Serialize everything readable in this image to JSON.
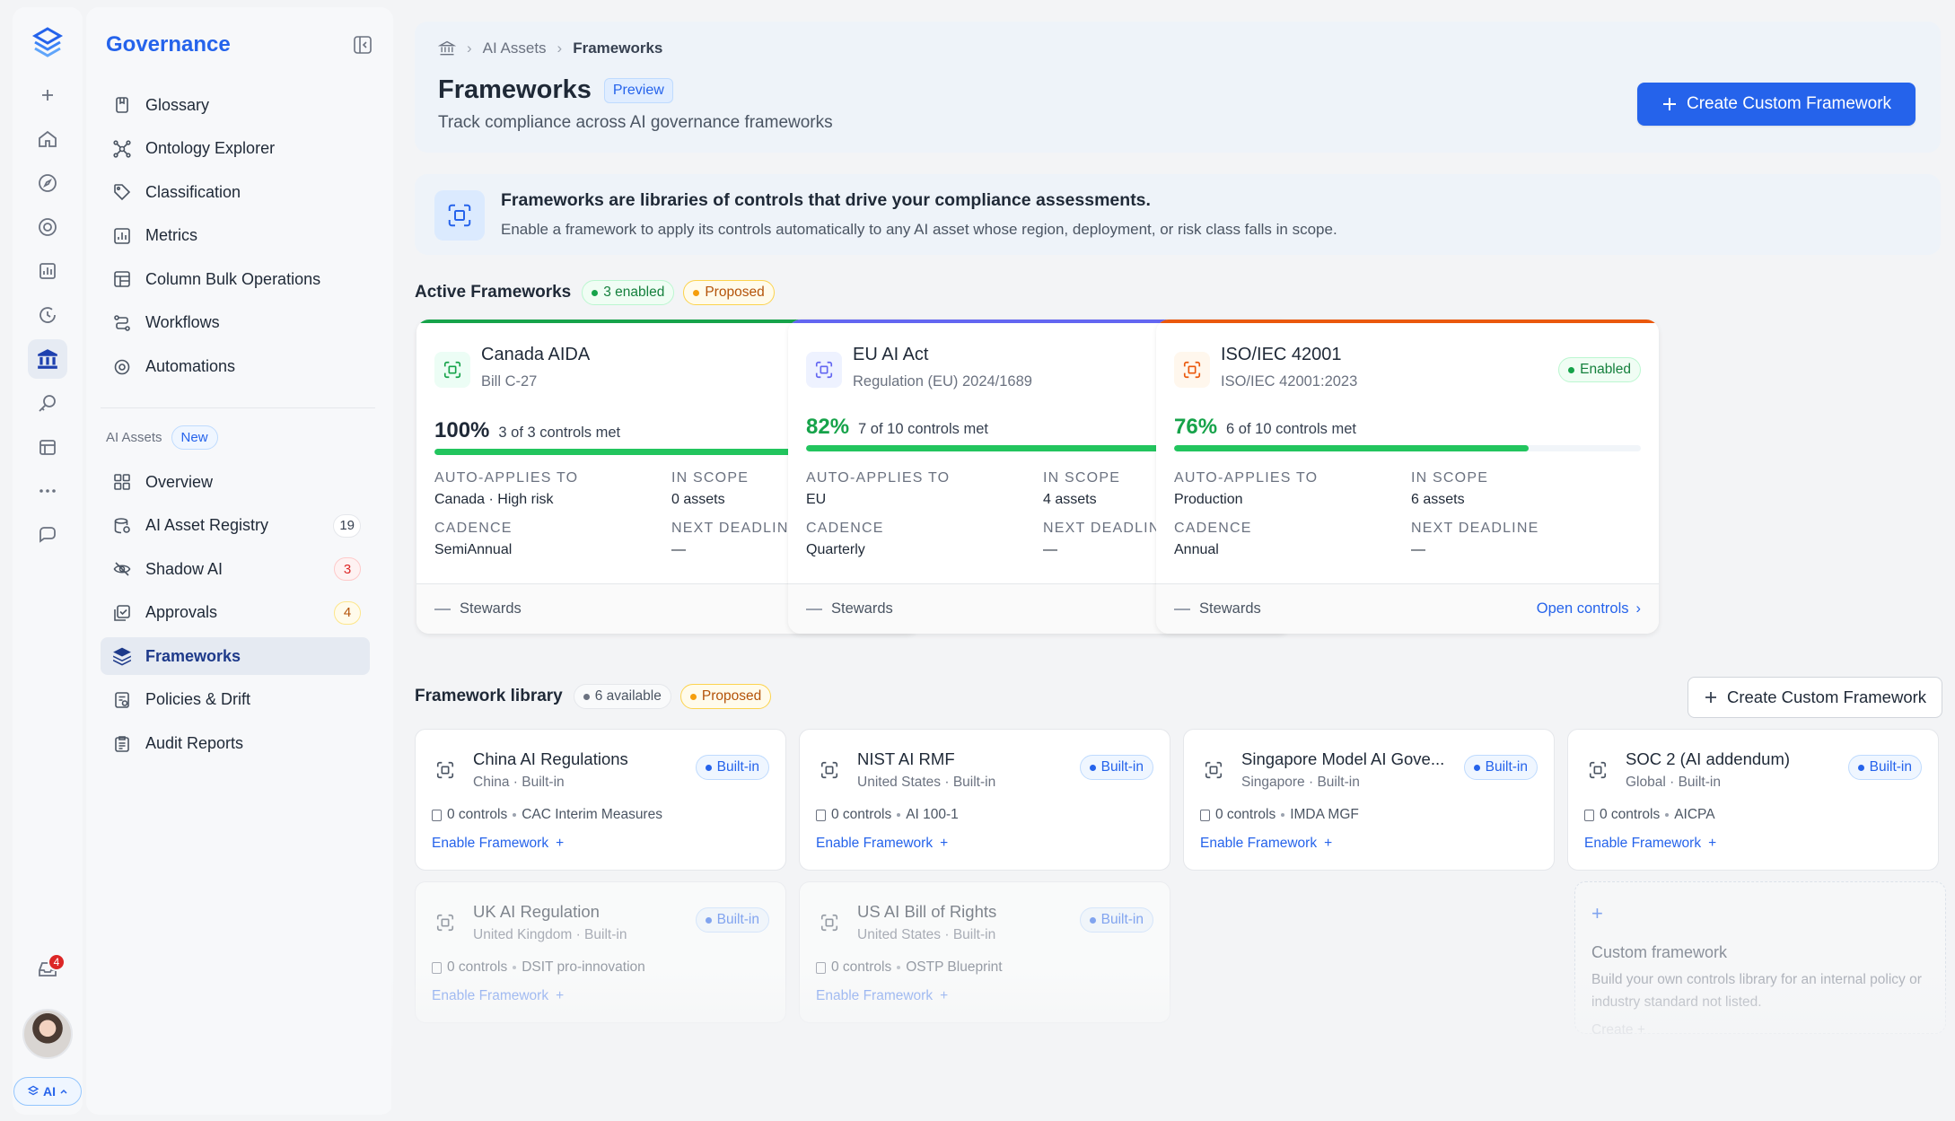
{
  "rail": {
    "icons": [
      "logo-stack-icon",
      "plus-icon",
      "home-icon",
      "compass-icon",
      "target-icon",
      "chart-icon",
      "refresh-clock-icon",
      "governance-bank-icon",
      "key-search-icon",
      "calendar-grid-icon",
      "more-icon",
      "chat-icon"
    ],
    "inbox_count": "4",
    "ai_label": "AI"
  },
  "sidebar": {
    "title": "Governance",
    "items": [
      {
        "label": "Glossary",
        "icon": "book-icon"
      },
      {
        "label": "Ontology Explorer",
        "icon": "graph-icon"
      },
      {
        "label": "Classification",
        "icon": "tag-icon"
      },
      {
        "label": "Metrics",
        "icon": "metrics-icon"
      },
      {
        "label": "Column Bulk Operations",
        "icon": "table-icon"
      },
      {
        "label": "Workflows",
        "icon": "workflow-icon"
      },
      {
        "label": "Automations",
        "icon": "automation-icon"
      }
    ],
    "ai_section": "AI Assets",
    "ai_badge": "New",
    "ai_items": [
      {
        "label": "Overview",
        "icon": "grid-icon",
        "count": ""
      },
      {
        "label": "AI Asset Registry",
        "icon": "registry-icon",
        "count": "19"
      },
      {
        "label": "Shadow AI",
        "icon": "eye-off-icon",
        "count": "3"
      },
      {
        "label": "Approvals",
        "icon": "approval-icon",
        "count": "4"
      },
      {
        "label": "Frameworks",
        "icon": "layers-icon",
        "count": ""
      },
      {
        "label": "Policies & Drift",
        "icon": "policy-icon",
        "count": ""
      },
      {
        "label": "Audit Reports",
        "icon": "audit-icon",
        "count": ""
      }
    ]
  },
  "header": {
    "crumb1": "AI Assets",
    "crumb2": "Frameworks",
    "title": "Frameworks",
    "badge": "Preview",
    "subtitle": "Track compliance across AI governance frameworks",
    "create_label": "Create Custom Framework"
  },
  "info": {
    "title": "Frameworks are libraries of controls that drive your compliance assessments.",
    "desc": "Enable a framework to apply its controls automatically to any AI asset whose region, deployment, or risk class falls in scope."
  },
  "active": {
    "title": "Active Frameworks",
    "enabled_count": "3 enabled",
    "proposed": "Proposed",
    "labels": {
      "auto": "AUTO-APPLIES TO",
      "scope": "IN SCOPE",
      "cadence": "CADENCE",
      "deadline": "NEXT DEADLINE",
      "stewards": "Stewards",
      "open": "Open controls",
      "enabled": "Enabled"
    },
    "cards": [
      {
        "name": "Canada AIDA",
        "sub": "Bill C-27",
        "pct": "100%",
        "progress": 1.0,
        "met": "3 of 3 controls met",
        "auto": "Canada · High risk",
        "scope": "0 assets",
        "cadence": "SemiAnnual",
        "deadline": "—",
        "accent": "#16a34a",
        "pct_color": "#1f2937",
        "icon_bg": "#ecfdf5",
        "icon_color": "#16a34a"
      },
      {
        "name": "EU AI Act",
        "sub": "Regulation (EU) 2024/1689",
        "pct": "82%",
        "progress": 0.82,
        "met": "7 of 10 controls met",
        "auto": "EU",
        "scope": "4 assets",
        "cadence": "Quarterly",
        "deadline": "—",
        "accent": "#6366f1",
        "pct_color": "#16a34a",
        "icon_bg": "#eef2ff",
        "icon_color": "#6366f1"
      },
      {
        "name": "ISO/IEC 42001",
        "sub": "ISO/IEC 42001:2023",
        "pct": "76%",
        "progress": 0.76,
        "met": "6 of 10 controls met",
        "auto": "Production",
        "scope": "6 assets",
        "cadence": "Annual",
        "deadline": "—",
        "accent": "#ea580c",
        "pct_color": "#16a34a",
        "icon_bg": "#fff7ed",
        "icon_color": "#ea580c"
      }
    ]
  },
  "library": {
    "title": "Framework library",
    "available": "6 available",
    "proposed": "Proposed",
    "create_label": "Create Custom Framework",
    "builtin": "Built-in",
    "enable": "Enable Framework",
    "cards": [
      {
        "name": "China AI Regulations",
        "sub": "China · Built-in",
        "controls": "0 controls",
        "ref": "CAC Interim Measures"
      },
      {
        "name": "NIST AI RMF",
        "sub": "United States · Built-in",
        "controls": "0 controls",
        "ref": "AI 100-1"
      },
      {
        "name": "Singapore Model AI Gove...",
        "sub": "Singapore · Built-in",
        "controls": "0 controls",
        "ref": "IMDA MGF"
      },
      {
        "name": "SOC 2 (AI addendum)",
        "sub": "Global · Built-in",
        "controls": "0 controls",
        "ref": "AICPA"
      },
      {
        "name": "UK AI Regulation",
        "sub": "United Kingdom · Built-in",
        "controls": "0 controls",
        "ref": "DSIT pro-innovation"
      },
      {
        "name": "US AI Bill of Rights",
        "sub": "United States · Built-in",
        "controls": "0 controls",
        "ref": "OSTP Blueprint"
      }
    ],
    "custom": {
      "title": "Custom framework",
      "desc": "Build your own controls library for an internal policy or industry standard not listed.",
      "cta": "Create"
    }
  }
}
